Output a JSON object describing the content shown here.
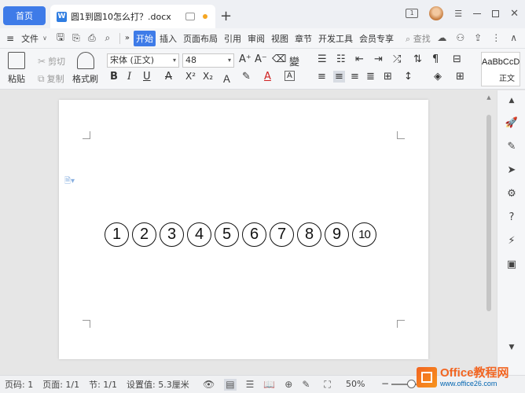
{
  "titlebar": {
    "home_tab": "首页",
    "doc_icon": "W",
    "doc_name": "圆1到圆10怎么打？.docx",
    "new_tab": "+",
    "win_box_label": "1"
  },
  "menubar": {
    "file_label": "文件",
    "tabs": [
      "开始",
      "插入",
      "页面布局",
      "引用",
      "审阅",
      "视图",
      "章节",
      "开发工具",
      "会员专享"
    ],
    "active_tab": "开始",
    "search_label": "查找"
  },
  "ribbon": {
    "paste_label": "粘贴",
    "cut_label": "剪切",
    "copy_label": "复制",
    "format_painter_label": "格式刷",
    "font_name": "宋体 (正文)",
    "font_size": "48",
    "styles_sample": "AaBbCcD",
    "styles_label": "正文",
    "bold": "B",
    "italic": "I",
    "underline": "U",
    "strikethrough": "A",
    "superscript": "X²",
    "subscript": "X₂"
  },
  "document": {
    "circled_numbers": [
      "1",
      "2",
      "3",
      "4",
      "5",
      "6",
      "7",
      "8",
      "9",
      "10"
    ]
  },
  "statusbar": {
    "page_num": "页码: 1",
    "pages": "页面: 1/1",
    "section": "节: 1/1",
    "setting": "设置值: 5.3厘米",
    "zoom": "50%"
  },
  "watermark": {
    "line1": "Office教程网",
    "line2": "www.office26.com"
  },
  "colors": {
    "accent": "#3e7be8",
    "word_blue": "#2f7de1",
    "unsaved_dot": "#f5a623",
    "watermark_orange": "#f26522"
  }
}
